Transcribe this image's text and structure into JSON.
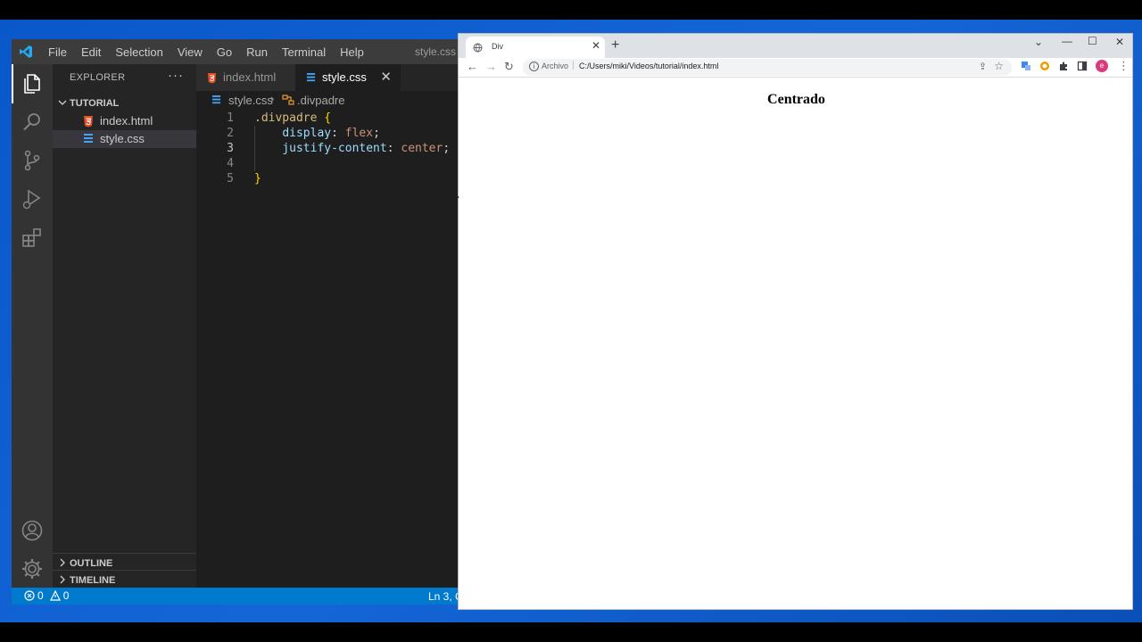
{
  "vscode": {
    "menu": [
      "File",
      "Edit",
      "Selection",
      "View",
      "Go",
      "Run",
      "Terminal",
      "Help"
    ],
    "window_title": "style.css",
    "explorer": {
      "header": "EXPLORER",
      "more": "···",
      "folder": "TUTORIAL",
      "files": [
        "index.html",
        "style.css"
      ],
      "outline": "OUTLINE",
      "timeline": "TIMELINE"
    },
    "tabs": [
      {
        "label": "index.html",
        "icon": "html5-icon"
      },
      {
        "label": "style.css",
        "icon": "css3-icon",
        "close": "✕"
      }
    ],
    "breadcrumb": {
      "file": "style.css",
      "symbol": ".divpadre"
    },
    "code": {
      "line_numbers": [
        "1",
        "2",
        "3",
        "4",
        "5"
      ],
      "selector": ".divpadre",
      "open_brace": "{",
      "prop1": "display",
      "val1": "flex",
      "prop2": "justify-content",
      "val2": "center",
      "close_brace": "}",
      "colon": ": ",
      "semi": ";"
    },
    "status": {
      "errors": "0",
      "warnings": "0",
      "position": "Ln 3, C"
    },
    "colors": {
      "statusbar": "#007acc",
      "activitybar": "#333333",
      "sidebar": "#252526",
      "editor": "#1e1e1e"
    }
  },
  "browser": {
    "tab_title": "Div",
    "tab_close": "✕",
    "new_tab": "+",
    "controls": {
      "chevron": "⌄",
      "minimize": "—",
      "maximize": "☐",
      "close": "✕"
    },
    "omnibox": {
      "scheme_label": "Archivo",
      "url": "C:/Users/miki/Videos/tutorial/index.html"
    },
    "profile_initial": "e",
    "page_text": "Centrado"
  }
}
